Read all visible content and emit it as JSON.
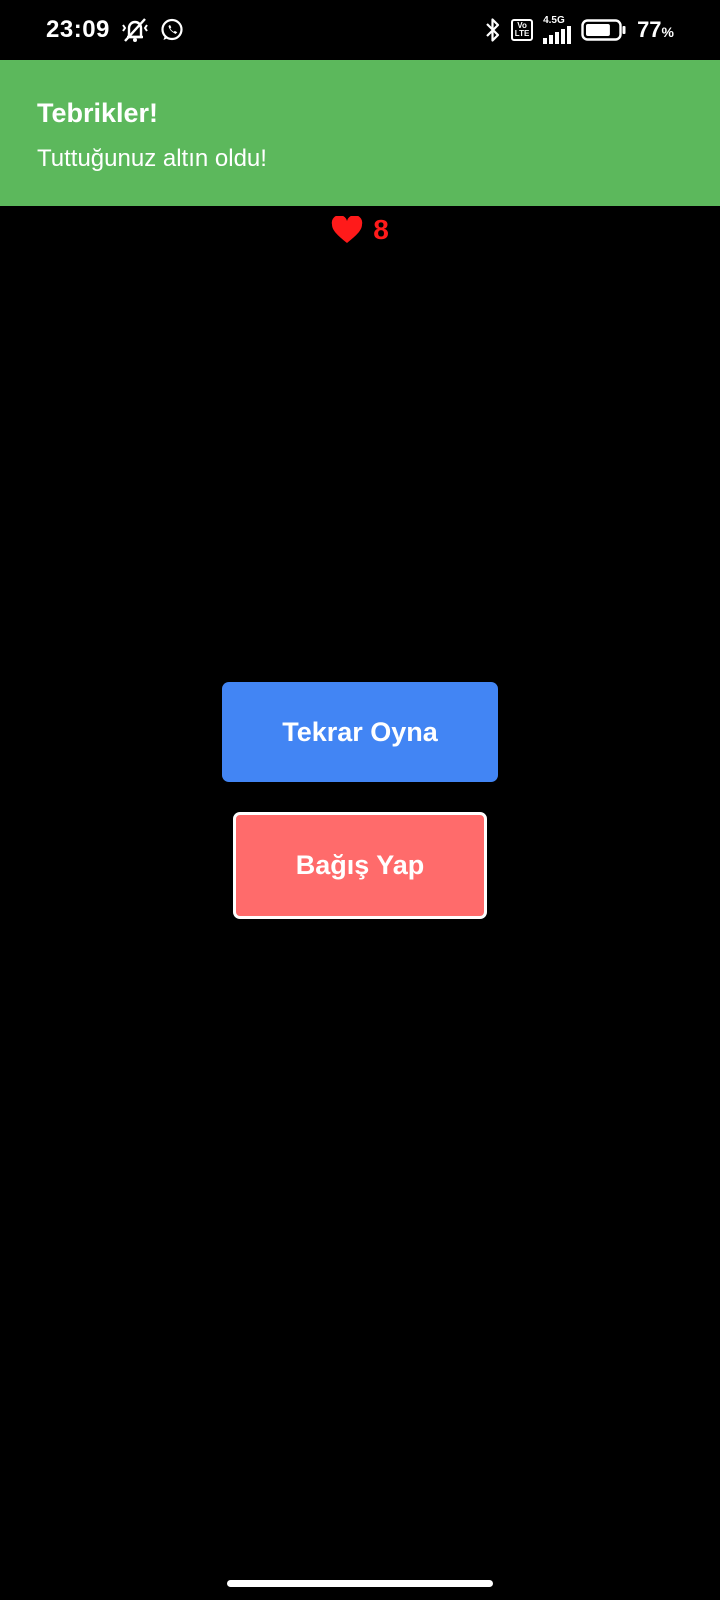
{
  "status_bar": {
    "time": "23:09",
    "network_type": "4.5G",
    "volte_top": "Vo",
    "volte_bottom": "LTE",
    "battery_percent": "77",
    "battery_unit": "%",
    "battery_level": 0.77,
    "icons": [
      "vibrate-off-icon",
      "whatsapp-icon",
      "bluetooth-icon",
      "volte-icon",
      "signal-icon",
      "battery-icon"
    ]
  },
  "toast": {
    "title": "Tebrikler!",
    "message": "Tuttuğunuz altın oldu!",
    "background_color": "#5cb85c"
  },
  "lives": {
    "icon": "heart-icon",
    "count": "8",
    "color": "#ff1a1a"
  },
  "buttons": {
    "play_again": {
      "label": "Tekrar Oyna",
      "color": "#4285f4"
    },
    "donate": {
      "label": "Bağış Yap",
      "color": "#ff6b6b"
    }
  }
}
